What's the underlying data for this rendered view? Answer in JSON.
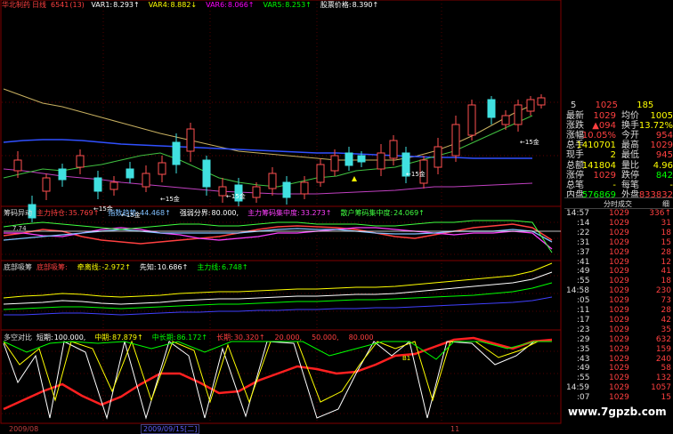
{
  "header": {
    "stock_name": "华北制药",
    "period": "日线",
    "code": "6541",
    "params": "(13)",
    "items": [
      {
        "label": "VAR1:",
        "value": "8.293↑",
        "color": "#ffffff"
      },
      {
        "label": "VAR4:",
        "value": "8.882↓",
        "color": "#ffff00"
      },
      {
        "label": "VAR6:",
        "value": "8.066↑",
        "color": "#ff00ff"
      },
      {
        "label": "VAR5:",
        "value": "8.253↑",
        "color": "#00ff00"
      },
      {
        "label": "股票价格:",
        "value": "8.390↑",
        "color": "#ffffff"
      }
    ]
  },
  "main_annotations": {
    "left_value": "7.74",
    "gold_labels": [
      "15金",
      "15金",
      "15金",
      "15金",
      "15金",
      "15金"
    ],
    "price_labels": [
      "5.63"
    ]
  },
  "panel2": {
    "title": "筹码异动",
    "items": [
      {
        "label": "主力持仓:",
        "value": "35.769↑",
        "color": "#ff4040"
      },
      {
        "label": "指数趋势:",
        "value": "44.468↑",
        "color": "#80c0ff"
      },
      {
        "label": "强弱分界:",
        "value": "80.000,",
        "color": "#ffffff"
      },
      {
        "label": "主力筹码集中度:",
        "value": "33.273↑",
        "color": "#ff40ff"
      },
      {
        "label": "散户筹码集中度:",
        "value": "24.069↑",
        "color": "#40ff40"
      }
    ]
  },
  "panel3": {
    "title": "底部吸筹",
    "items": [
      {
        "label": "底部吸筹:",
        "value": "",
        "color": "#ff4040"
      },
      {
        "label": "牵离线:",
        "value": "-2.972↑",
        "color": "#ffff00"
      },
      {
        "label": "先知:",
        "value": "10.686↑",
        "color": "#ffffff"
      },
      {
        "label": "主力线:",
        "value": "6.748↑",
        "color": "#00ff00"
      }
    ]
  },
  "panel4": {
    "title": "多空对比",
    "items": [
      {
        "label": "短期:",
        "value": "100.000,",
        "color": "#ffffff"
      },
      {
        "label": "中期:",
        "value": "87.879↑",
        "color": "#ffff00"
      },
      {
        "label": "中长期:",
        "value": "86.172↑",
        "color": "#00ff00"
      },
      {
        "label": "长期:",
        "value": "30.320↑",
        "color": "#ff4040"
      },
      {
        "label": "",
        "value": "20.000,",
        "color": "#ff4040"
      },
      {
        "label": "",
        "value": "50.000,",
        "color": "#ff4040"
      },
      {
        "label": "",
        "value": "80.000",
        "color": "#ff4040"
      }
    ],
    "marker": "B1"
  },
  "timeline": {
    "date_label": "2009/09/15[二]",
    "left_label": "2009/08",
    "right_label": "11"
  },
  "quote_panel": {
    "top": {
      "a": "5",
      "b": "1025",
      "c": "185"
    },
    "rows": [
      {
        "l1": "最新",
        "v1": "1029",
        "l2": "均价",
        "v2": "1005",
        "c1": "#ff4040",
        "c2": "#ffff00"
      },
      {
        "l1": "涨跌",
        "v1": "▲094",
        "l2": "换手",
        "v2": "13.72%",
        "c1": "#ff4040",
        "c2": "#ffff00"
      },
      {
        "l1": "涨幅",
        "v1": "10.05%",
        "l2": "今开",
        "v2": "954",
        "c1": "#ff4040",
        "c2": "#ff4040"
      },
      {
        "l1": "总手",
        "v1": "1410701",
        "l2": "最高",
        "v2": "1029",
        "c1": "#ffff00",
        "c2": "#ff4040"
      },
      {
        "l1": "现手",
        "v1": "2",
        "l2": "最低",
        "v2": "945",
        "c1": "#ffff00",
        "c2": "#ff4040"
      },
      {
        "l1": "总额",
        "v1": "141804",
        "l2": "量比",
        "v2": "4.96",
        "c1": "#ffff00",
        "c2": "#ffff00"
      },
      {
        "l1": "涨停",
        "v1": "1029",
        "l2": "跌停",
        "v2": "842",
        "c1": "#ff4040",
        "c2": "#00ff00"
      },
      {
        "l1": "总笔",
        "v1": "-",
        "l2": "每笔",
        "v2": "-",
        "c1": "#ffff00",
        "c2": "#ffff00"
      },
      {
        "l1": "内盘",
        "v1": "576869",
        "l2": "外盘",
        "v2": "833832",
        "c1": "#00ff00",
        "c2": "#ff4040"
      }
    ],
    "tabs": {
      "left": "分时成交",
      "right": "细"
    },
    "ticks": [
      {
        "t": "14:57",
        "p": "1029",
        "v": "336↑"
      },
      {
        "t": ":14",
        "p": "1029",
        "v": "31"
      },
      {
        "t": ":22",
        "p": "1029",
        "v": "18"
      },
      {
        "t": ":31",
        "p": "1029",
        "v": "15"
      },
      {
        "t": ":37",
        "p": "1029",
        "v": "28"
      },
      {
        "t": ":41",
        "p": "1029",
        "v": "12"
      },
      {
        "t": ":49",
        "p": "1029",
        "v": "41"
      },
      {
        "t": ":55",
        "p": "1029",
        "v": "18"
      },
      {
        "t": "14:58",
        "p": "1029",
        "v": "230"
      },
      {
        "t": ":05",
        "p": "1029",
        "v": "73"
      },
      {
        "t": ":11",
        "p": "1029",
        "v": "28"
      },
      {
        "t": ":17",
        "p": "1029",
        "v": "42"
      },
      {
        "t": ":23",
        "p": "1029",
        "v": "35"
      },
      {
        "t": ":29",
        "p": "1029",
        "v": "632"
      },
      {
        "t": ":35",
        "p": "1029",
        "v": "159"
      },
      {
        "t": ":43",
        "p": "1029",
        "v": "240"
      },
      {
        "t": ":49",
        "p": "1029",
        "v": "58"
      },
      {
        "t": ":55",
        "p": "1029",
        "v": "132"
      },
      {
        "t": "14:59",
        "p": "1029",
        "v": "1057"
      },
      {
        "t": ":07",
        "p": "1029",
        "v": "15"
      }
    ]
  },
  "watermark": "www.7gpzb.com"
}
